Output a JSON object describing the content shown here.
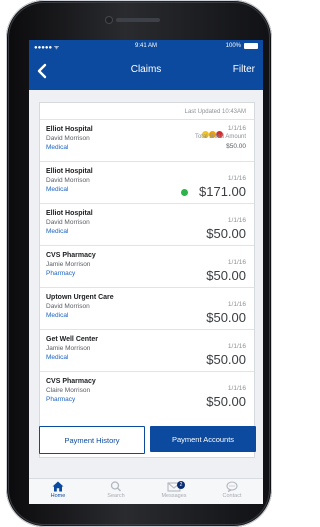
{
  "status": {
    "carrier": "●●●●● ᯤ",
    "time": "9:41 AM",
    "battery": "100%"
  },
  "nav": {
    "title": "Claims",
    "filter": "Filter"
  },
  "list": {
    "last_updated": "Last Updated 10:43AM",
    "claims": [
      {
        "provider": "Elliot Hospital",
        "patient": "David Morrison",
        "category": "Medical",
        "date": "1/1/16",
        "billed_label": "Total Billed Amount",
        "amount": "$50.00",
        "status_dots": [
          "#f5c518",
          "#e9a414",
          "#d62b2b"
        ]
      },
      {
        "provider": "Elliot Hospital",
        "patient": "David Morrison",
        "category": "Medical",
        "date": "1/1/16",
        "amount": "$171.00",
        "status_dot": "#2db34a"
      },
      {
        "provider": "Elliot Hospital",
        "patient": "David Morrison",
        "category": "Medical",
        "date": "1/1/16",
        "amount": "$50.00"
      },
      {
        "provider": "CVS Pharmacy",
        "patient": "Jamie Morrison",
        "category": "Pharmacy",
        "date": "1/1/16",
        "amount": "$50.00"
      },
      {
        "provider": "Uptown Urgent Care",
        "patient": "David Morrison",
        "category": "Medical",
        "date": "1/1/16",
        "amount": "$50.00"
      },
      {
        "provider": "Get Well Center",
        "patient": "Jamie Morrison",
        "category": "Medical",
        "date": "1/1/16",
        "amount": "$50.00"
      },
      {
        "provider": "CVS Pharmacy",
        "patient": "Claire Morrison",
        "category": "Pharmacy",
        "date": "1/1/16",
        "amount": "$50.00"
      }
    ]
  },
  "buttons": {
    "history": "Payment History",
    "accounts": "Payment Accounts"
  },
  "tabs": [
    {
      "label": "Home",
      "icon": "home-icon",
      "active": true
    },
    {
      "label": "Search",
      "icon": "search-icon"
    },
    {
      "label": "Messages",
      "icon": "envelope-icon",
      "badge": "2"
    },
    {
      "label": "Contact",
      "icon": "chat-icon"
    }
  ],
  "colors": {
    "brand": "#0b4a9e",
    "link": "#1b63c2"
  }
}
